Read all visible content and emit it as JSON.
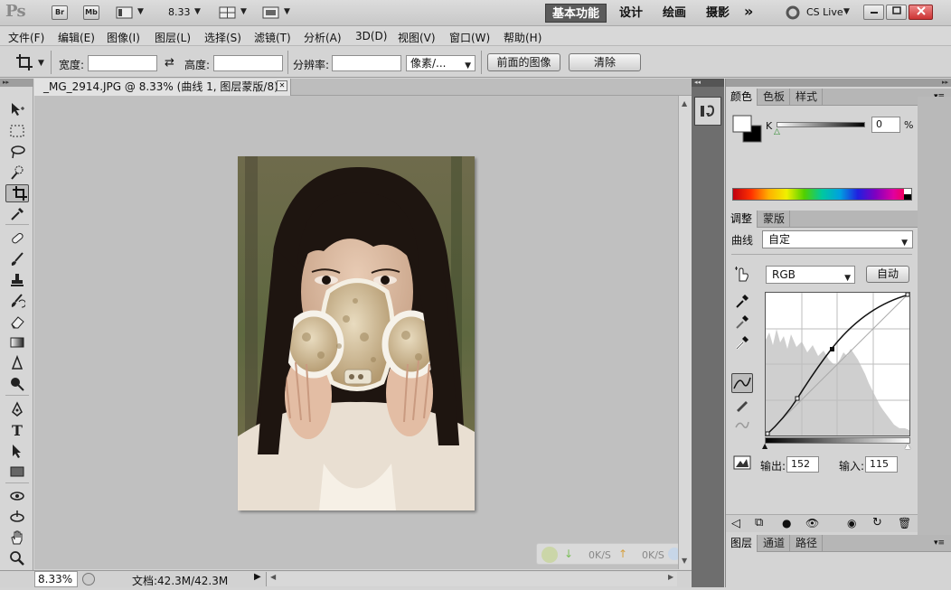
{
  "appbar": {
    "logo": "Ps",
    "bridge": "Br",
    "minibridge": "Mb",
    "zoom": "8.33",
    "workspaces": [
      "基本功能",
      "设计",
      "绘画",
      "摄影"
    ],
    "more": "»",
    "cslive": "CS Live"
  },
  "menu": [
    "文件(F)",
    "编辑(E)",
    "图像(I)",
    "图层(L)",
    "选择(S)",
    "滤镜(T)",
    "分析(A)",
    "3D(D)",
    "视图(V)",
    "窗口(W)",
    "帮助(H)"
  ],
  "options": {
    "width_label": "宽度:",
    "height_label": "高度:",
    "resolution_label": "分辨率:",
    "unit": "像素/...",
    "front_image": "前面的图像",
    "clear": "清除"
  },
  "document": {
    "tab_title": "_MG_2914.JPG @ 8.33% (曲线 1, 图层蒙版/8) *",
    "close": "✕"
  },
  "status": {
    "zoom": "8.33%",
    "doc": "文档:42.3M/42.3M"
  },
  "netmeter": {
    "down": "0K/S",
    "up": "0K/S"
  },
  "color_panel": {
    "tabs": [
      "颜色",
      "色板",
      "样式"
    ],
    "channel": "K",
    "value": "0",
    "unit": "%"
  },
  "adjust_panel": {
    "tabs": [
      "调整",
      "蒙版"
    ],
    "curves_label": "曲线",
    "preset": "自定",
    "channel": "RGB",
    "auto": "自动",
    "output_label": "输出:",
    "output_value": "152",
    "input_label": "输入:",
    "input_value": "115"
  },
  "layers_panel": {
    "tabs": [
      "图层",
      "通道",
      "路径"
    ]
  },
  "colors": {
    "accent_workspace": "#5b5b5b",
    "canvas_bg": "#c0c0c0"
  }
}
